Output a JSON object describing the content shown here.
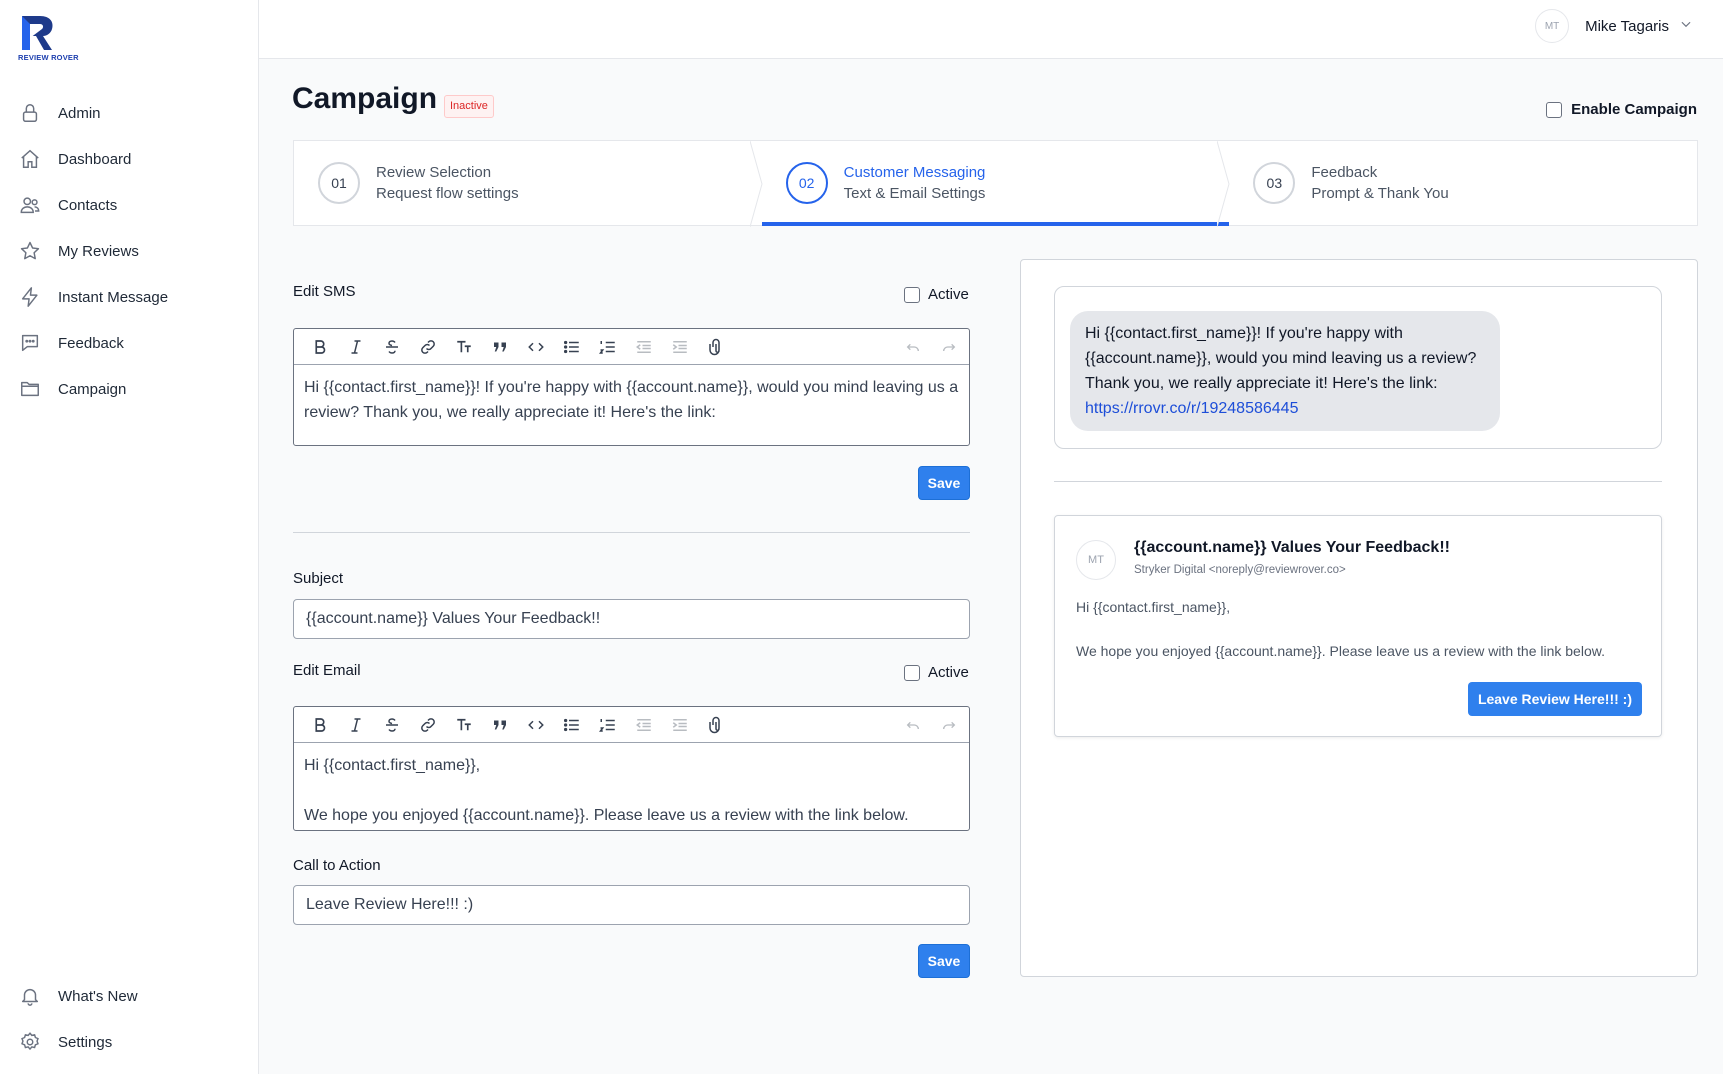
{
  "app": {
    "logo_text": "REVIEW ROVER",
    "accent": "#2f80ed"
  },
  "sidebar": {
    "items": [
      {
        "label": "Admin",
        "icon": "lock-icon"
      },
      {
        "label": "Dashboard",
        "icon": "home-icon"
      },
      {
        "label": "Contacts",
        "icon": "users-icon"
      },
      {
        "label": "My Reviews",
        "icon": "star-icon"
      },
      {
        "label": "Instant Message",
        "icon": "lightning-icon"
      },
      {
        "label": "Feedback",
        "icon": "chat-icon"
      },
      {
        "label": "Campaign",
        "icon": "folder-icon"
      }
    ],
    "bottom_items": [
      {
        "label": "What's New",
        "icon": "bell-icon"
      },
      {
        "label": "Settings",
        "icon": "gear-icon"
      }
    ]
  },
  "header": {
    "user_initials": "MT",
    "user_name": "Mike Tagaris"
  },
  "page": {
    "title": "Campaign",
    "status": "Inactive",
    "enable_label": "Enable Campaign",
    "enable_checked": false
  },
  "steps": [
    {
      "num": "01",
      "title": "Review Selection",
      "subtitle": "Request flow settings",
      "active": false
    },
    {
      "num": "02",
      "title": "Customer Messaging",
      "subtitle": "Text & Email Settings",
      "active": true
    },
    {
      "num": "03",
      "title": "Feedback",
      "subtitle": "Prompt & Thank You",
      "active": false
    }
  ],
  "sms": {
    "label": "Edit SMS",
    "active_label": "Active",
    "active": false,
    "body": "Hi {{contact.first_name}}! If you're happy with {{account.name}}, would you mind leaving us a review? Thank you, we really appreciate it! Here's the link:",
    "save_label": "Save"
  },
  "email": {
    "subject_label": "Subject",
    "subject_value": "{{account.name}} Values Your Feedback!!",
    "label": "Edit Email",
    "active_label": "Active",
    "active": false,
    "body_line1": "Hi {{contact.first_name}},",
    "body_line2": "We hope you enjoyed {{account.name}}. Please leave us a review with the link below.",
    "cta_label": "Call to Action",
    "cta_value": "Leave Review Here!!! :)",
    "save_label": "Save"
  },
  "preview": {
    "sms_text": "Hi {{contact.first_name}}! If you're happy with {{account.name}}, would you mind leaving us a review? Thank you, we really appreciate it! Here's the link:",
    "sms_link": "https://rrovr.co/r/19248586445",
    "email_avatar": "MT",
    "email_subject": "{{account.name}} Values Your Feedback!!",
    "email_from": "Stryker Digital <noreply@reviewrover.co>",
    "email_greeting": "Hi {{contact.first_name}},",
    "email_body": "We hope you enjoyed {{account.name}}. Please leave us a review with the link below.",
    "email_button": "Leave Review Here!!! :)"
  }
}
